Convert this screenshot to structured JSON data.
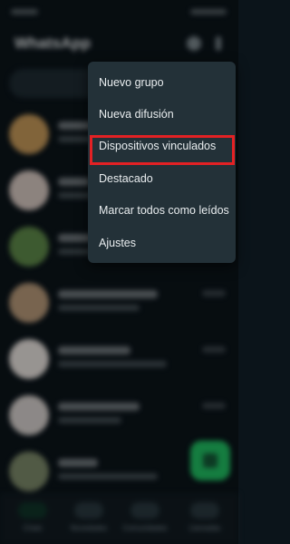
{
  "app": {
    "title": "WhatsApp"
  },
  "menu": {
    "items": [
      {
        "label": "Nuevo grupo"
      },
      {
        "label": "Nueva difusión"
      },
      {
        "label": "Dispositivos vinculados"
      },
      {
        "label": "Destacado"
      },
      {
        "label": "Marcar todos como leídos"
      },
      {
        "label": "Ajustes"
      }
    ],
    "highlighted_item": "Dispositivos vinculados"
  },
  "colors": {
    "background": "#0b141a",
    "menu_background": "#233138",
    "menu_text": "#e9edef",
    "highlight_border": "#e32124",
    "fab": "#21c063"
  },
  "bottom_nav": {
    "items": [
      {
        "label": "Chats",
        "icon": "chat-icon"
      },
      {
        "label": "Novedades",
        "icon": "status-icon"
      },
      {
        "label": "Comunidades",
        "icon": "communities-icon"
      },
      {
        "label": "Llamadas",
        "icon": "phone-icon"
      }
    ]
  }
}
